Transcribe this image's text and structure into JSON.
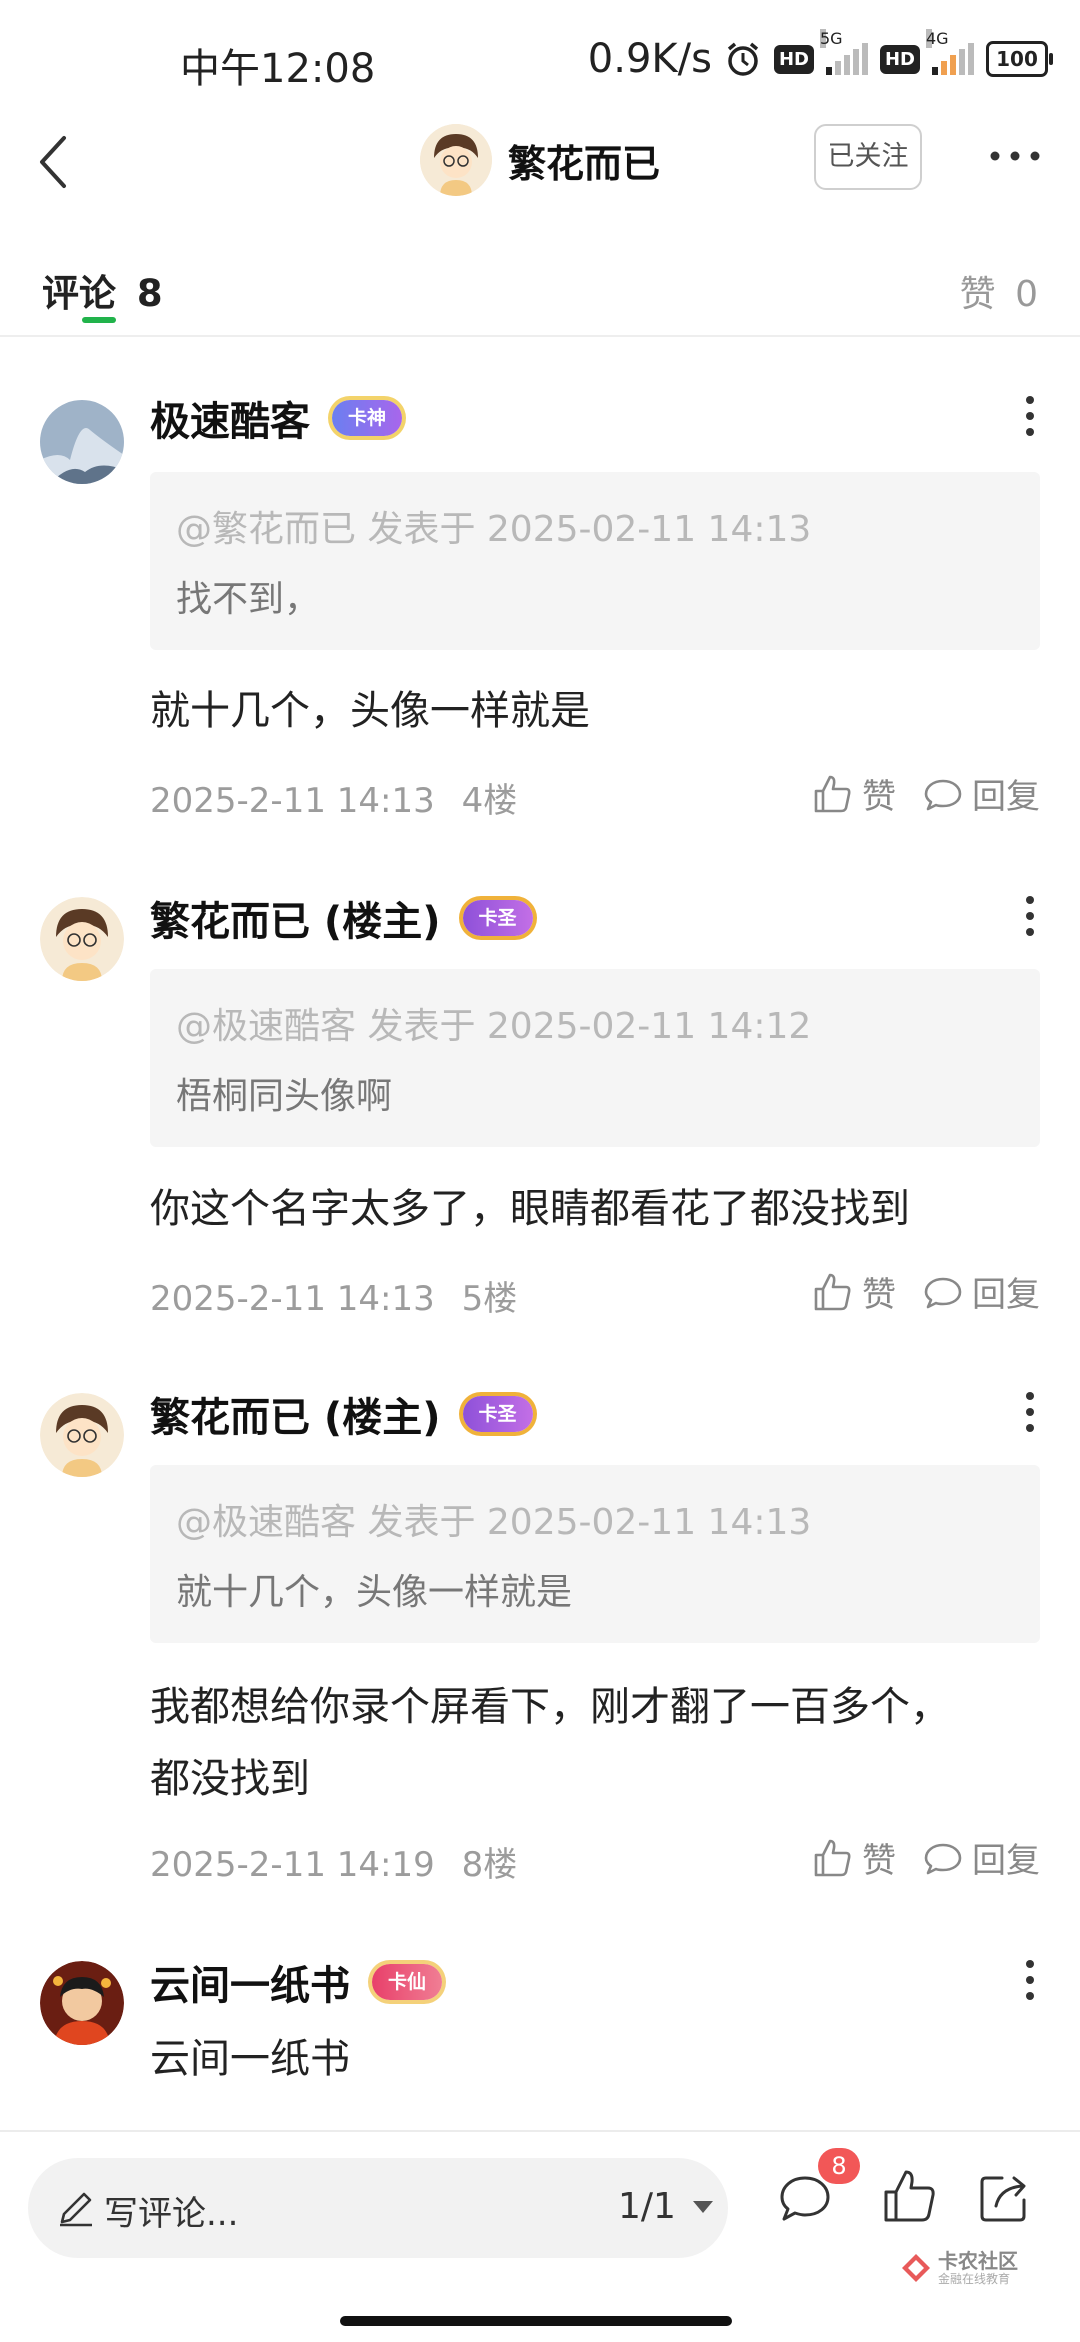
{
  "status_bar": {
    "time": "中午12:08",
    "speed": "0.9K/s",
    "hd1": "HD",
    "net1": "5G",
    "hd2": "HD",
    "net2": "4G",
    "battery": "100"
  },
  "header": {
    "user_name": "繁花而已",
    "follow_label": "已关注"
  },
  "tabs": {
    "comments_label": "评论",
    "comments_count": "8",
    "likes_label": "赞",
    "likes_count": "0"
  },
  "comments": [
    {
      "author": "极速酷客",
      "badge": "卡神",
      "quote_meta": "@繁花而已 发表于 2025-02-11 14:13",
      "quote_text": "找不到，",
      "text": "就十几个，头像一样就是",
      "time": "2025-2-11 14:13",
      "floor": "4楼",
      "like_label": "赞",
      "reply_label": "回复"
    },
    {
      "author": "繁花而已 (楼主)",
      "badge": "卡圣",
      "quote_meta": "@极速酷客 发表于 2025-02-11 14:12",
      "quote_text": "梧桐同头像啊",
      "text": "你这个名字太多了，眼睛都看花了都没找到",
      "time": "2025-2-11 14:13",
      "floor": "5楼",
      "like_label": "赞",
      "reply_label": "回复"
    },
    {
      "author": "繁花而已 (楼主)",
      "badge": "卡圣",
      "quote_meta": "@极速酷客 发表于 2025-02-11 14:13",
      "quote_text": "就十几个，头像一样就是",
      "text_line1": "我都想给你录个屏看下，刚才翻了一百多个，",
      "text_line2": "都没找到",
      "time": "2025-2-11 14:19",
      "floor": "8楼",
      "like_label": "赞",
      "reply_label": "回复"
    },
    {
      "author": "云间一纸书",
      "badge": "卡仙",
      "text": "云间一纸书"
    }
  ],
  "bottom_bar": {
    "input_placeholder": "写评论...",
    "page_indicator": "1/1",
    "comment_badge": "8"
  },
  "watermark": {
    "main": "卡农社区",
    "sub": "金融在线教育"
  },
  "colors": {
    "accent_green": "#21b34b",
    "badge_red": "#f25757"
  },
  "icons": [
    "back-arrow-icon",
    "more-dots-icon",
    "kebab-menu-icon",
    "thumb-up-icon",
    "reply-bubble-icon",
    "pencil-icon",
    "chevron-down-icon",
    "comment-icon",
    "like-icon",
    "share-icon"
  ]
}
